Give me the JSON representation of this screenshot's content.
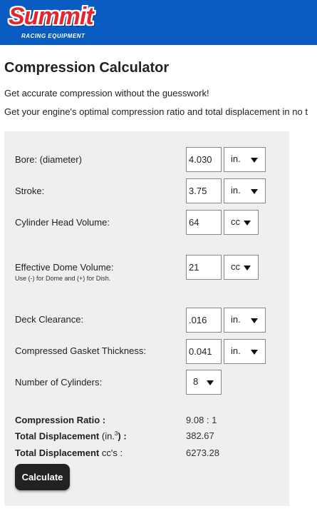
{
  "brand": {
    "name": "Summit",
    "tagline": "RACING EQUIPMENT",
    "header_color": "#0a5cc2",
    "logo_color": "#e3262e"
  },
  "page": {
    "title": "Compression Calculator",
    "intro": [
      "Get accurate compression without the guesswork!",
      "Get your engine's optimal compression ratio and total displacement in no t"
    ]
  },
  "form": {
    "bore": {
      "label": "Bore: (diameter)",
      "value": "4.030",
      "unit": "in."
    },
    "stroke": {
      "label": "Stroke:",
      "value": "3.75",
      "unit": "in."
    },
    "head_volume": {
      "label": "Cylinder Head Volume:",
      "value": "64",
      "unit": "cc"
    },
    "dome_volume": {
      "label": "Effective Dome Volume:",
      "note": "Use (-) for Dome and (+) for Dish.",
      "value": "21",
      "unit": "cc"
    },
    "deck_clearance": {
      "label": "Deck Clearance:",
      "value": ".016",
      "unit": "in."
    },
    "gasket_thickness": {
      "label": "Compressed Gasket Thickness:",
      "value": "0.041",
      "unit": "in."
    },
    "cylinders": {
      "label": "Number of Cylinders:",
      "value": "8"
    }
  },
  "results": {
    "compression_ratio": {
      "label": "Compression Ratio :",
      "value": "9.08 : 1"
    },
    "total_displacement_in": {
      "label": "Total Displacement",
      "unit_pre": "(in.",
      "unit_sup": "3",
      "unit_post": ") :",
      "value": "382.67"
    },
    "total_displacement_cc": {
      "label": "Total Displacement",
      "unit": "cc's :",
      "value": "6273.28"
    }
  },
  "calculate_label": "Calculate"
}
